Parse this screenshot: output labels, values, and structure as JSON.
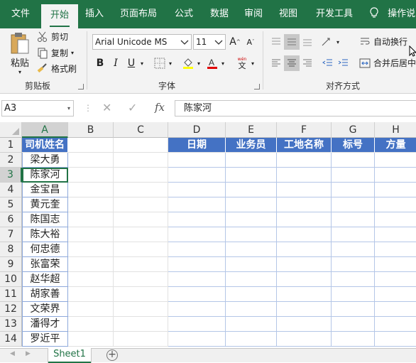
{
  "tabs": [
    {
      "label": "文件"
    },
    {
      "label": "开始"
    },
    {
      "label": "插入"
    },
    {
      "label": "页面布局"
    },
    {
      "label": "公式"
    },
    {
      "label": "数据"
    },
    {
      "label": "审阅"
    },
    {
      "label": "视图"
    },
    {
      "label": "开发工具"
    },
    {
      "label": "操作说明"
    }
  ],
  "ribbon": {
    "clipboard": {
      "paste": "粘贴",
      "cut": "剪切",
      "copy": "复制",
      "format_painter": "格式刷",
      "label": "剪贴板"
    },
    "font": {
      "name": "Arial Unicode MS",
      "size": "11",
      "bold": "B",
      "italic": "I",
      "underline": "U",
      "label": "字体",
      "wen": "文"
    },
    "alignment": {
      "wrap": "自动换行",
      "merge": "合并后居中",
      "label": "对齐方式"
    }
  },
  "formula_bar": {
    "name_box": "A3",
    "fx": "fx",
    "value": "陈家河"
  },
  "columns": [
    "A",
    "B",
    "C",
    "D",
    "E",
    "F",
    "G",
    "H"
  ],
  "rows": [
    "1",
    "2",
    "3",
    "4",
    "5",
    "6",
    "7",
    "8",
    "9",
    "10",
    "11",
    "12",
    "13",
    "14"
  ],
  "header_a": "司机姓名",
  "headers_right": [
    "日期",
    "业务员",
    "工地名称",
    "标号",
    "方量"
  ],
  "drivers": [
    "梁大勇",
    "陈家河",
    "金宝昌",
    "黄元奎",
    "陈国志",
    "陈大裕",
    "何忠德",
    "张富荣",
    "赵华超",
    "胡家善",
    "文荣界",
    "潘得才",
    "罗近平"
  ],
  "sheet": {
    "name": "Sheet1",
    "add": "+"
  },
  "colors": {
    "accent": "#217346",
    "header_fill": "#4472c4"
  }
}
